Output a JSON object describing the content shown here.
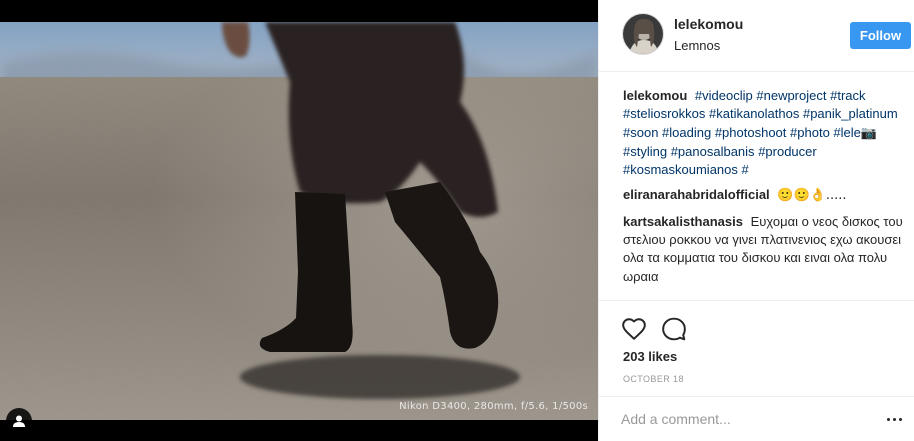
{
  "post": {
    "username": "lelekomou",
    "location": "Lemnos",
    "follow_label": "Follow",
    "photo_watermark": "Nikon D3400, 280mm, f/5.6, 1/500s",
    "likes": "203 likes",
    "date": "OCTOBER 18",
    "add_comment_placeholder": "Add a comment..."
  },
  "caption": {
    "user": "lelekomou",
    "hashtags": [
      "#videoclip",
      "#newproject",
      "#track",
      "#steliosrokkos",
      "#katikanolathos",
      "#panik_platinum",
      "#soon",
      "#loading",
      "#photoshoot",
      "#photo",
      "#lele"
    ],
    "camera_emoji": "📷",
    "hashtags2": [
      "#styling",
      "#panosalbanis",
      "#producer",
      "#kosmaskoumianos",
      "#"
    ]
  },
  "comments": [
    {
      "user": "eliranarahabridalofficial",
      "text": "🙂🙂👌....."
    },
    {
      "user": "kartsakalisthanasis",
      "text": "Ευχομαι ο νεος δισκος του στελιου ροκκου να γινει πλατινενιος εχω ακουσει ολα τα κομματια του δισκου και ειναι ολα πολυ ωραια"
    }
  ],
  "icons": {
    "like": "heart-icon",
    "comment": "comment-bubble-icon",
    "more": "more-options-icon",
    "tagged_users": "user-tag-icon"
  },
  "colors": {
    "follow_button": "#3897f0",
    "hashtag": "#003569",
    "muted": "#999999",
    "text": "#262626"
  }
}
